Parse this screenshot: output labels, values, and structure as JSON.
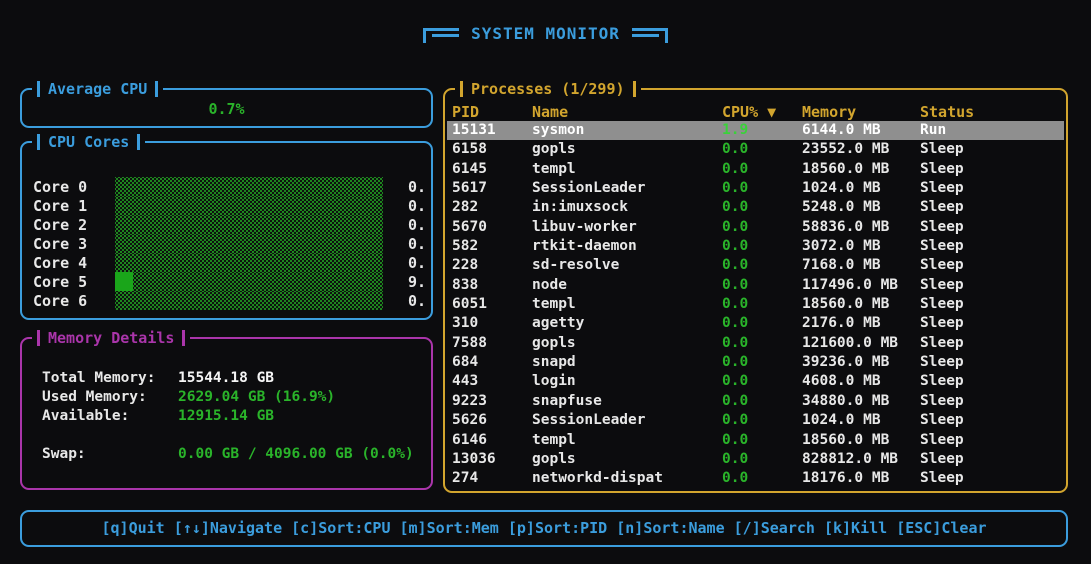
{
  "app": {
    "title": "SYSTEM MONITOR"
  },
  "colors": {
    "background": "#0c0c0e",
    "blue": "#3b9ddd",
    "green": "#2ab42a",
    "bright_green": "#3ad23a",
    "yellow": "#d2a52e",
    "magenta": "#aa35aa",
    "white": "#e8e8e8",
    "selected_bg": "#8f8f8f",
    "bar_fill": "#1aa51a",
    "bar_dot": "#1f8c1f"
  },
  "avg_cpu": {
    "title": "Average CPU",
    "value": "0.7%"
  },
  "cpu_cores": {
    "title": "CPU Cores",
    "cores": [
      {
        "label": "Core 0",
        "value": "0.",
        "bar_fraction": 0
      },
      {
        "label": "Core 1",
        "value": "0.",
        "bar_fraction": 0
      },
      {
        "label": "Core 2",
        "value": "0.",
        "bar_fraction": 0
      },
      {
        "label": "Core 3",
        "value": "0.",
        "bar_fraction": 0
      },
      {
        "label": "Core 4",
        "value": "0.",
        "bar_fraction": 0
      },
      {
        "label": "Core 5",
        "value": "9.",
        "bar_fraction": 0.067
      },
      {
        "label": "Core 6",
        "value": "0.",
        "bar_fraction": 0
      }
    ]
  },
  "memory": {
    "title": "Memory Details",
    "rows": [
      {
        "label": "Total Memory:",
        "value": "15544.18 GB"
      },
      {
        "label": "Used Memory:",
        "value": "2629.04 GB (16.9%)"
      },
      {
        "label": "Available:",
        "value": "12915.14 GB"
      },
      {
        "label": "Swap:",
        "value": "0.00 GB / 4096.00 GB (0.0%)"
      }
    ]
  },
  "processes": {
    "title": "Processes (1/299)",
    "columns": {
      "pid": "PID",
      "name": "Name",
      "cpu": "CPU% ▼",
      "memory": "Memory",
      "status": "Status"
    },
    "selected_index": 0,
    "rows": [
      {
        "pid": "15131",
        "name": "sysmon",
        "cpu": "1.9",
        "memory": "6144.0 MB",
        "status": "Run"
      },
      {
        "pid": "6158",
        "name": "gopls",
        "cpu": "0.0",
        "memory": "23552.0 MB",
        "status": "Sleep"
      },
      {
        "pid": "6145",
        "name": "templ",
        "cpu": "0.0",
        "memory": "18560.0 MB",
        "status": "Sleep"
      },
      {
        "pid": "5617",
        "name": "SessionLeader",
        "cpu": "0.0",
        "memory": "1024.0 MB",
        "status": "Sleep"
      },
      {
        "pid": "282",
        "name": "in:imuxsock",
        "cpu": "0.0",
        "memory": "5248.0 MB",
        "status": "Sleep"
      },
      {
        "pid": "5670",
        "name": "libuv-worker",
        "cpu": "0.0",
        "memory": "58836.0 MB",
        "status": "Sleep"
      },
      {
        "pid": "582",
        "name": "rtkit-daemon",
        "cpu": "0.0",
        "memory": "3072.0 MB",
        "status": "Sleep"
      },
      {
        "pid": "228",
        "name": "sd-resolve",
        "cpu": "0.0",
        "memory": "7168.0 MB",
        "status": "Sleep"
      },
      {
        "pid": "838",
        "name": "node",
        "cpu": "0.0",
        "memory": "117496.0 MB",
        "status": "Sleep"
      },
      {
        "pid": "6051",
        "name": "templ",
        "cpu": "0.0",
        "memory": "18560.0 MB",
        "status": "Sleep"
      },
      {
        "pid": "310",
        "name": "agetty",
        "cpu": "0.0",
        "memory": "2176.0 MB",
        "status": "Sleep"
      },
      {
        "pid": "7588",
        "name": "gopls",
        "cpu": "0.0",
        "memory": "121600.0 MB",
        "status": "Sleep"
      },
      {
        "pid": "684",
        "name": "snapd",
        "cpu": "0.0",
        "memory": "39236.0 MB",
        "status": "Sleep"
      },
      {
        "pid": "443",
        "name": "login",
        "cpu": "0.0",
        "memory": "4608.0 MB",
        "status": "Sleep"
      },
      {
        "pid": "9223",
        "name": "snapfuse",
        "cpu": "0.0",
        "memory": "34880.0 MB",
        "status": "Sleep"
      },
      {
        "pid": "5626",
        "name": "SessionLeader",
        "cpu": "0.0",
        "memory": "1024.0 MB",
        "status": "Sleep"
      },
      {
        "pid": "6146",
        "name": "templ",
        "cpu": "0.0",
        "memory": "18560.0 MB",
        "status": "Sleep"
      },
      {
        "pid": "13036",
        "name": "gopls",
        "cpu": "0.0",
        "memory": "828812.0 MB",
        "status": "Sleep"
      },
      {
        "pid": "274",
        "name": "networkd-dispat",
        "cpu": "0.0",
        "memory": "18176.0 MB",
        "status": "Sleep"
      }
    ]
  },
  "footer": {
    "keybindings": "[q]Quit [↑↓]Navigate [c]Sort:CPU [m]Sort:Mem [p]Sort:PID [n]Sort:Name [/]Search [k]Kill [ESC]Clear"
  }
}
